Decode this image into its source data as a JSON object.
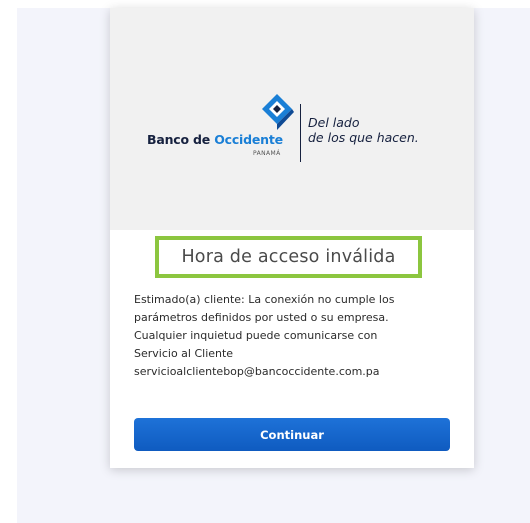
{
  "logo": {
    "brand_prefix": "Banco de ",
    "brand_accent": "Occidente",
    "country": "PANAMÁ",
    "tagline_line1": "Del lado",
    "tagline_line2": "de los que hacen.",
    "icon": "diamond-logo-icon"
  },
  "dialog": {
    "title": "Hora de acceso inválida",
    "message_lines": [
      "Estimado(a) cliente: La conexión no cumple los",
      "parámetros definidos por usted o su empresa.",
      "Cualquier inquietud puede comunicarse con",
      "Servicio al Cliente",
      "servicioalclientebop@bancoccidente.com.pa"
    ],
    "button_label": "Continuar"
  },
  "colors": {
    "brand_dark": "#16213f",
    "brand_blue": "#1a7fd6",
    "highlight_border": "#8cc63f",
    "button_blue": "#1567cc",
    "page_background": "#f3f4fb"
  }
}
